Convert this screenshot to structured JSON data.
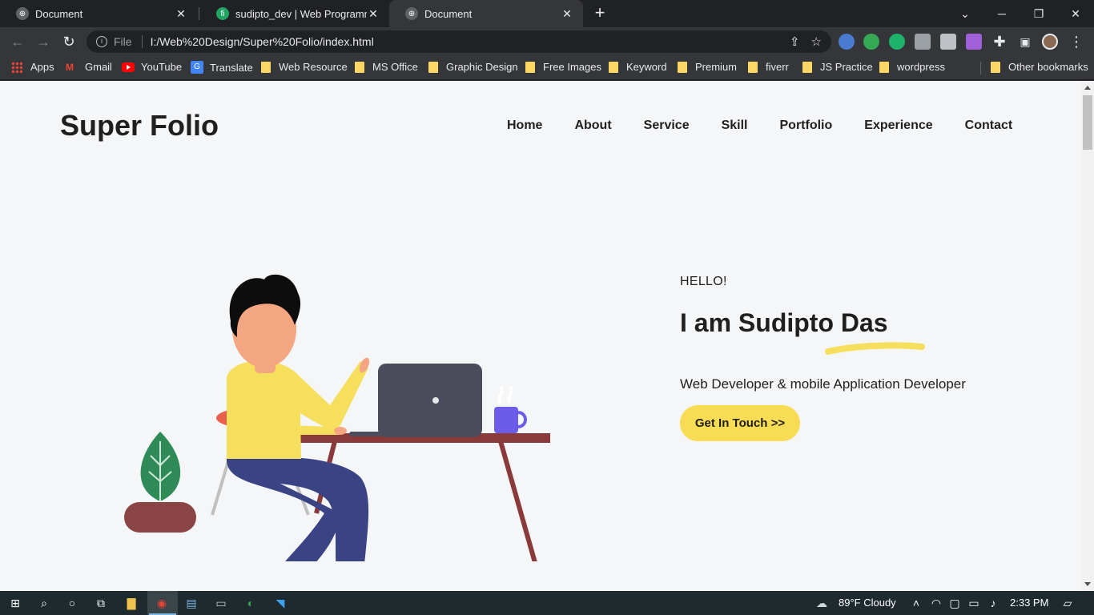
{
  "browser": {
    "tabs": [
      {
        "title": "Document",
        "active": false
      },
      {
        "title": "sudipto_dev | Web Programming",
        "active": false
      },
      {
        "title": "Document",
        "active": true
      }
    ],
    "url_scheme": "File",
    "url": "I:/Web%20Design/Super%20Folio/index.html",
    "bookmarks": [
      "Apps",
      "Gmail",
      "YouTube",
      "Translate",
      "Web Resource",
      "MS Office",
      "Graphic Design",
      "Free Images",
      "Keyword",
      "Premium",
      "fiverr",
      "JS Practice",
      "wordpress"
    ],
    "other_bookmarks": "Other bookmarks"
  },
  "site": {
    "logo": "Super Folio",
    "nav": [
      "Home",
      "About",
      "Service",
      "Skill",
      "Portfolio",
      "Experience",
      "Contact"
    ],
    "hero": {
      "greeting": "HELLO!",
      "heading": "I am Sudipto Das",
      "subtitle": "Web Developer & mobile Application Developer",
      "cta": "Get In Touch >>"
    },
    "colors": {
      "accent": "#f7dc54",
      "text": "#1f1f1f",
      "background": "#f5f6f8"
    }
  },
  "taskbar": {
    "weather": "89°F  Cloudy",
    "time": "2:33 PM"
  }
}
